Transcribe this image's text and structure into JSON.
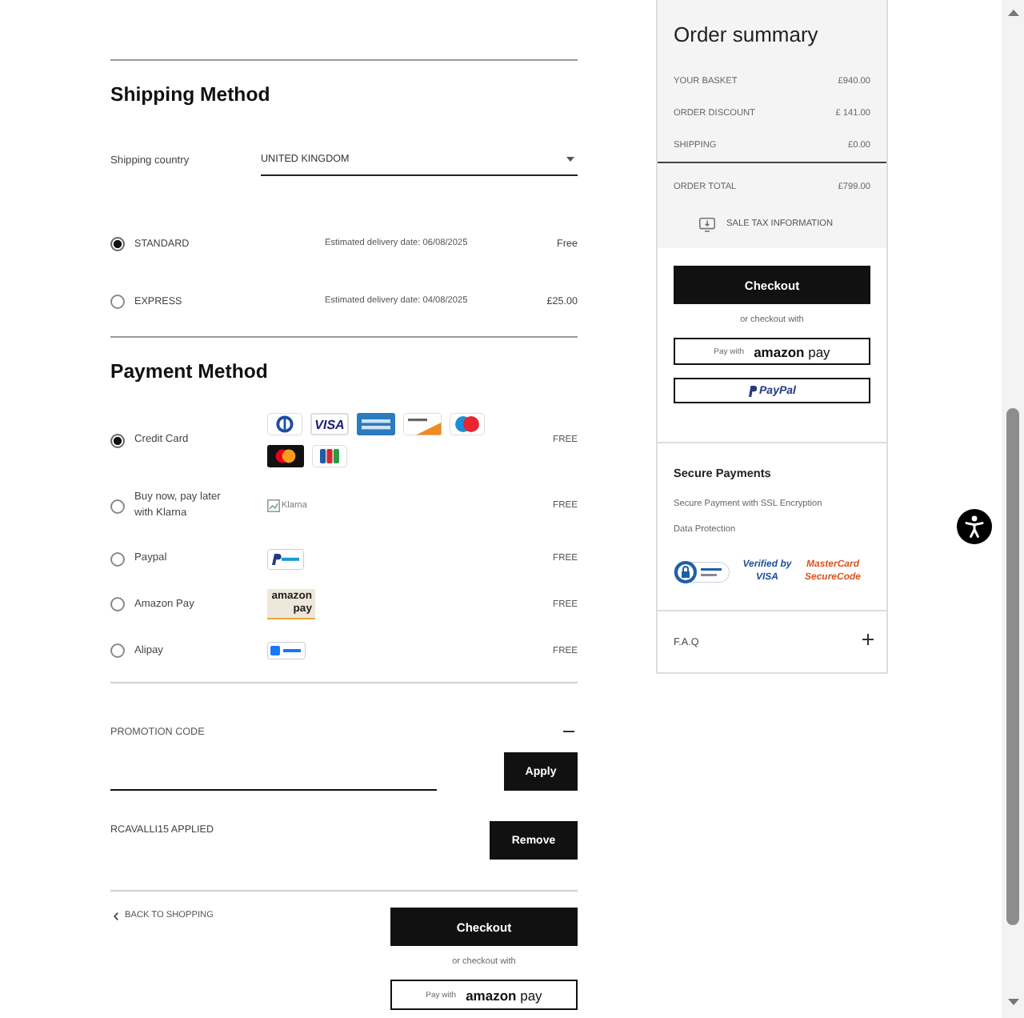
{
  "shipping_method": {
    "title": "Shipping Method",
    "country_label": "Shipping country",
    "country_value": "UNITED KINGDOM",
    "options": [
      {
        "label": "STANDARD",
        "delivery": "Estimated delivery date: 06/08/2025",
        "price": "Free",
        "selected": true
      },
      {
        "label": "EXPRESS",
        "delivery": "Estimated delivery date: 04/08/2025",
        "price": "£25.00",
        "selected": false
      }
    ]
  },
  "payment_method": {
    "title": "Payment Method",
    "options": [
      {
        "kind": "cards",
        "label": "Credit Card",
        "card_logos": [
          {
            "kind": "diners"
          },
          {
            "kind": "visa",
            "text": "VISA"
          },
          {
            "kind": "amex"
          },
          {
            "kind": "discover"
          },
          {
            "kind": "maestro"
          },
          {
            "kind": "mastercard"
          },
          {
            "kind": "jcb"
          }
        ],
        "price": "FREE",
        "selected": true
      },
      {
        "kind": "klarna",
        "label": "Buy now, pay later with Klarna",
        "logo_alt": "Klarna",
        "price": "FREE",
        "selected": false
      },
      {
        "kind": "paypal",
        "label": "Paypal",
        "price": "FREE",
        "selected": false
      },
      {
        "kind": "amazon",
        "label": "Amazon Pay",
        "logo_text": "amazon pay",
        "price": "FREE",
        "selected": false
      },
      {
        "kind": "alipay",
        "label": "Alipay",
        "price": "FREE",
        "selected": false
      }
    ]
  },
  "promotion": {
    "label": "PROMOTION CODE",
    "expanded": true,
    "apply_button": "Apply",
    "applied_code": "RCAVALLI15 APPLIED",
    "remove_button": "Remove"
  },
  "cart_actions": {
    "back_link": "BACK TO SHOPPING",
    "checkout_button": "Checkout",
    "alt_label": "or checkout with",
    "amazon_button": {
      "prefix": "Pay with",
      "brand": "**amazon** pay"
    }
  },
  "order_summary": {
    "title": "Order summary",
    "rows": [
      {
        "label": "YOUR BASKET",
        "value": "£940.00"
      },
      {
        "label": "ORDER DISCOUNT",
        "value": "£ 141.00"
      },
      {
        "label": "SHIPPING",
        "value": "£0.00"
      }
    ],
    "total": {
      "label": "ORDER TOTAL",
      "value": "£799.00"
    },
    "tax_info": "SALE TAX INFORMATION",
    "checkout_button": "Checkout",
    "alt_label": "or checkout with",
    "amazon_button": {
      "prefix": "Pay with",
      "brand": "**amazon** pay"
    },
    "paypal_button": "PayPal"
  },
  "secure_payments": {
    "title": "Secure Payments",
    "lines": [
      "Secure Payment with SSL Encryption",
      "Data Protection"
    ],
    "badges": [
      {
        "kind": "seal"
      },
      {
        "kind": "verified",
        "text": "Verified by VISA"
      },
      {
        "kind": "securecode",
        "text": "MasterCard SecureCode"
      }
    ]
  },
  "faq": {
    "title": "F.A.Q",
    "expanded": false
  }
}
